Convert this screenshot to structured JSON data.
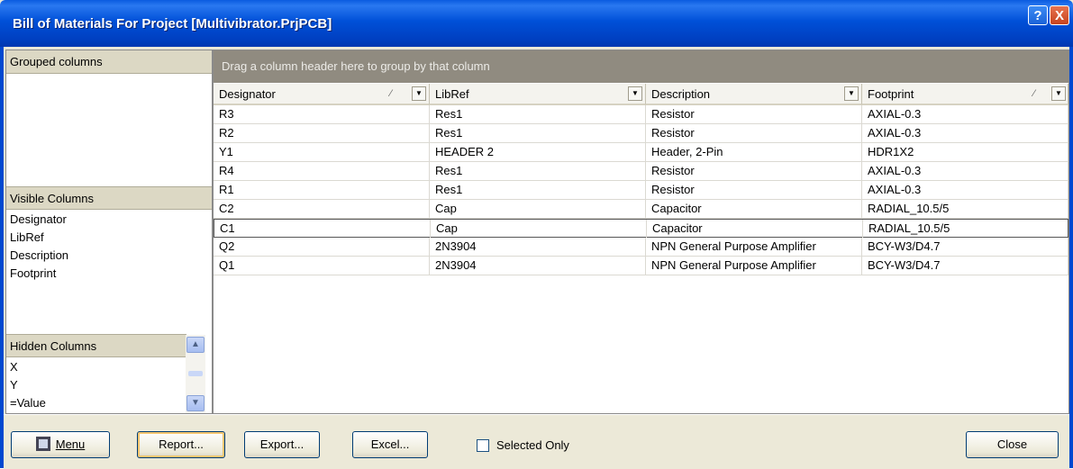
{
  "window": {
    "title": "Bill of Materials For Project [Multivibrator.PrjPCB]",
    "help_label": "?",
    "close_label": "X"
  },
  "left_panel": {
    "grouped_header": "Grouped columns",
    "visible_header": "Visible Columns",
    "visible_columns": [
      "Designator",
      "LibRef",
      "Description",
      "Footprint"
    ],
    "hidden_header": "Hidden Columns",
    "hidden_columns": [
      "X",
      "Y",
      "=Value"
    ]
  },
  "grid": {
    "group_hint": "Drag a column header here to group by that column",
    "columns": [
      "Designator",
      "LibRef",
      "Description",
      "Footprint"
    ],
    "rows": [
      [
        "R3",
        "Res1",
        "Resistor",
        "AXIAL-0.3"
      ],
      [
        "R2",
        "Res1",
        "Resistor",
        "AXIAL-0.3"
      ],
      [
        "Y1",
        "HEADER 2",
        "Header, 2-Pin",
        "HDR1X2"
      ],
      [
        "R4",
        "Res1",
        "Resistor",
        "AXIAL-0.3"
      ],
      [
        "R1",
        "Res1",
        "Resistor",
        "AXIAL-0.3"
      ],
      [
        "C2",
        "Cap",
        "Capacitor",
        "RADIAL_10.5/5"
      ],
      [
        "C1",
        "Cap",
        "Capacitor",
        "RADIAL_10.5/5"
      ],
      [
        "Q2",
        "2N3904",
        "NPN General Purpose Amplifier",
        "BCY-W3/D4.7"
      ],
      [
        "Q1",
        "2N3904",
        "NPN General Purpose Amplifier",
        "BCY-W3/D4.7"
      ]
    ]
  },
  "buttons": {
    "menu": "Menu",
    "report": "Report...",
    "export": "Export...",
    "excel": "Excel...",
    "selected_only": "Selected Only",
    "close": "Close"
  }
}
